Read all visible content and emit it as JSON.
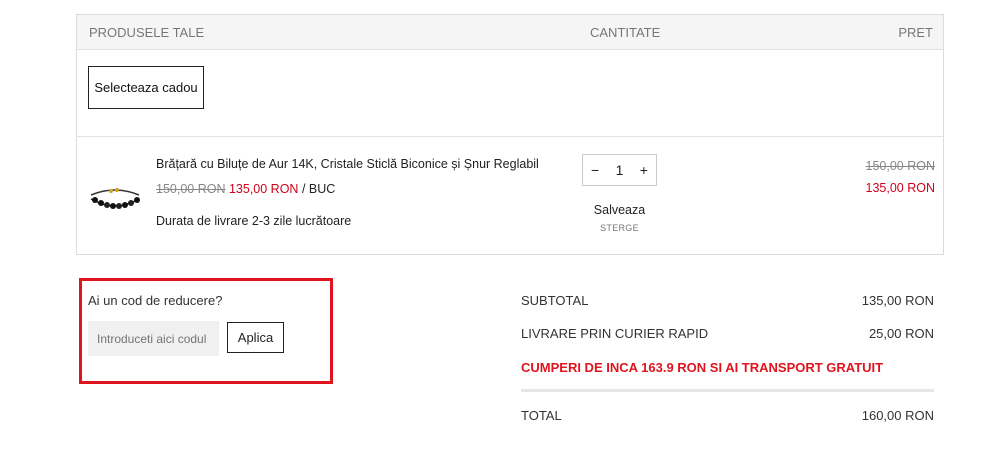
{
  "cart": {
    "headers": {
      "products": "PRODUSELE TALE",
      "quantity": "CANTITATE",
      "price": "PRET"
    },
    "gift_button": "Selecteaza cadou",
    "item": {
      "name": "Brățară cu Biluțe de Aur 14K, Cristale Sticlă Biconice și Șnur Reglabil",
      "old_price": "150,00 RON",
      "new_price": "135,00 RON",
      "unit": "/ BUC",
      "delivery": "Durata de livrare 2-3 zile lucrătoare",
      "quantity": "1",
      "minus": "−",
      "plus": "+",
      "save_label": "Salveaza",
      "remove_label": "STERGE",
      "total_old": "150,00 RON",
      "total_new": "135,00 RON"
    }
  },
  "coupon": {
    "label": "Ai un cod de reducere?",
    "placeholder": "Introduceti aici codul dvs.",
    "apply_label": "Aplica"
  },
  "summary": {
    "subtotal_label": "SUBTOTAL",
    "subtotal_value": "135,00 RON",
    "shipping_label": "LIVRARE PRIN CURIER RAPID",
    "shipping_value": "25,00 RON",
    "free_shipping_msg": "CUMPERI DE INCA 163.9 RON SI AI TRANSPORT GRATUIT",
    "total_label": "TOTAL",
    "total_value": "160,00 RON"
  },
  "colors": {
    "accent_red": "#d0021b",
    "highlight_border": "#e0141e"
  }
}
